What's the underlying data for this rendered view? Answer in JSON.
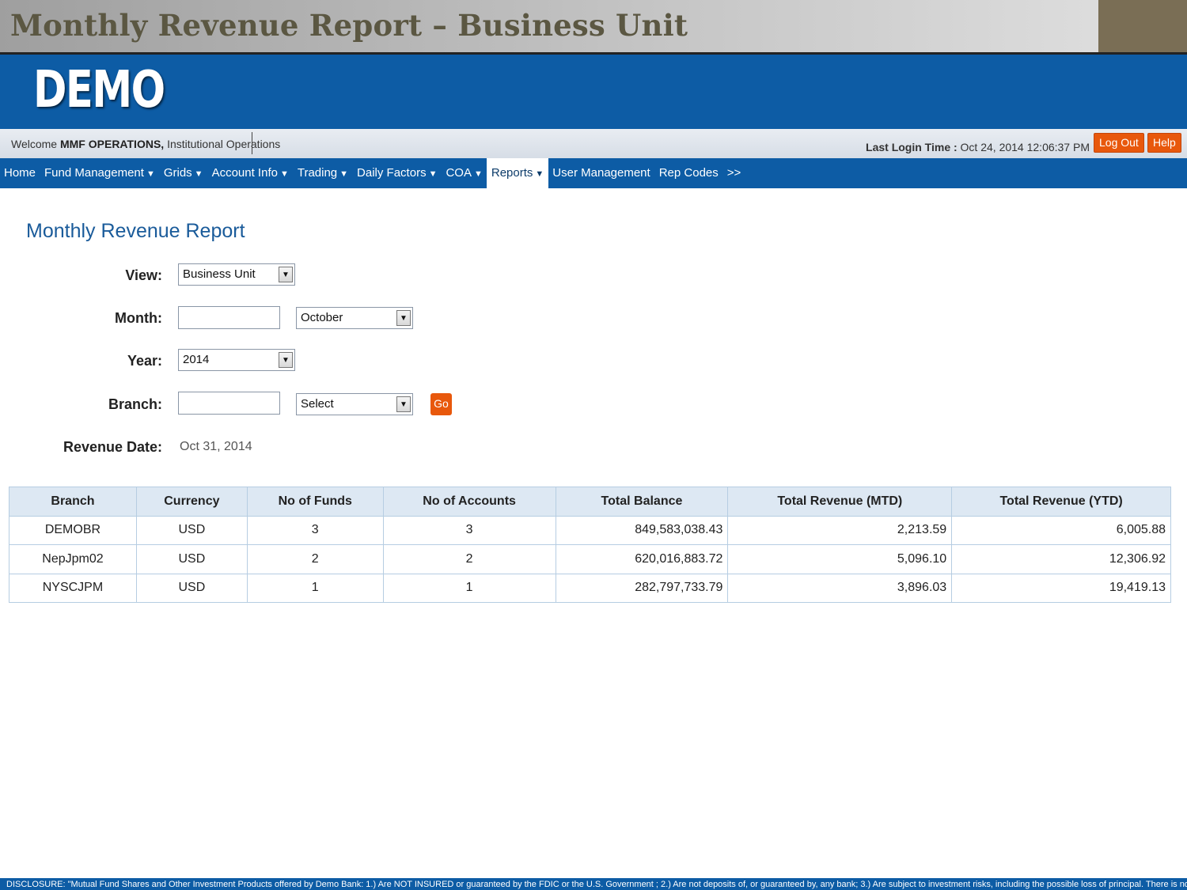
{
  "slide": {
    "title": "Monthly Revenue Report – Business Unit"
  },
  "brand": {
    "logo_text": "DEMO",
    "primary_color": "#0d5ca5",
    "accent_color": "#e8580c"
  },
  "welcome": {
    "prefix": "Welcome",
    "user": "MMF OPERATIONS,",
    "org": "Institutional Operations"
  },
  "last_login": {
    "label": "Last Login Time :",
    "value": "Oct 24, 2014 12:06:37 PM"
  },
  "buttons": {
    "logout": "Log Out",
    "help": "Help",
    "go": "Go"
  },
  "nav": {
    "items": [
      {
        "label": "Home",
        "dropdown": false
      },
      {
        "label": "Fund Management",
        "dropdown": true
      },
      {
        "label": "Grids",
        "dropdown": true
      },
      {
        "label": "Account Info",
        "dropdown": true
      },
      {
        "label": "Trading",
        "dropdown": true
      },
      {
        "label": "Daily Factors",
        "dropdown": true
      },
      {
        "label": "COA",
        "dropdown": true
      },
      {
        "label": "Reports",
        "dropdown": true,
        "active": true
      },
      {
        "label": "User Management",
        "dropdown": false
      },
      {
        "label": "Rep Codes",
        "dropdown": false
      },
      {
        "label": ">>",
        "dropdown": false
      }
    ],
    "dropdown_glyph": "▼"
  },
  "report": {
    "heading": "Monthly Revenue Report",
    "view_label": "View:",
    "view_value": "Business Unit",
    "month_label": "Month:",
    "month_value": "October",
    "year_label": "Year:",
    "year_value": "2014",
    "branch_label": "Branch:",
    "branch_value": "Select",
    "revenue_date_label": "Revenue Date:",
    "revenue_date_value": "Oct 31, 2014"
  },
  "table": {
    "headers": [
      "Branch",
      "Currency",
      "No of Funds",
      "No of Accounts",
      "Total Balance",
      "Total Revenue (MTD)",
      "Total Revenue (YTD)"
    ],
    "rows": [
      [
        "DEMOBR",
        "USD",
        "3",
        "3",
        "849,583,038.43",
        "2,213.59",
        "6,005.88"
      ],
      [
        "NepJpm02",
        "USD",
        "2",
        "2",
        "620,016,883.72",
        "5,096.10",
        "12,306.92"
      ],
      [
        "NYSCJPM",
        "USD",
        "1",
        "1",
        "282,797,733.79",
        "3,896.03",
        "19,419.13"
      ]
    ]
  },
  "icons": {
    "caret": "caret-down-icon"
  },
  "disclosure": "DISCLOSURE: \"Mutual Fund Shares and Other Investment Products offered by Demo Bank: 1.) Are NOT INSURED or guaranteed by the FDIC or the U.S. Government ; 2.) Are not deposits of, or guaranteed by, any bank; 3.) Are subject to investment risks, including the possible loss of principal. There is no assurance"
}
